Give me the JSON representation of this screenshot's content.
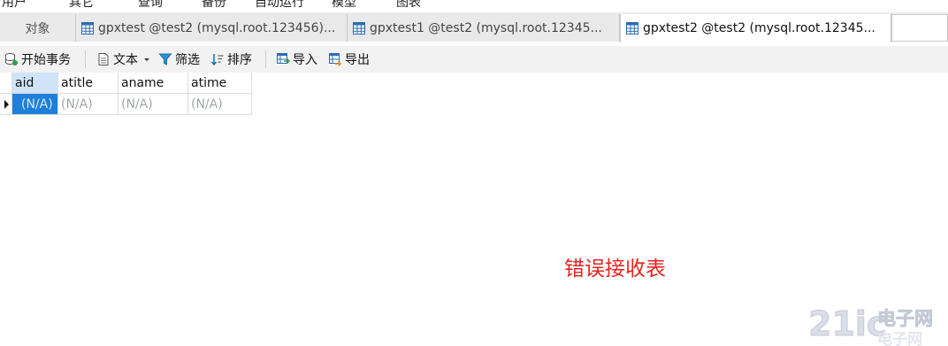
{
  "menubar": {
    "items": [
      "用户",
      "其它",
      "查询",
      "备份",
      "自动运行",
      "模型",
      "图表"
    ]
  },
  "tabs": {
    "objects_label": "对象",
    "items": [
      {
        "label": "gpxtest @test2 (mysql.root.123456)...",
        "icon": "table-icon",
        "active": false
      },
      {
        "label": "gpxtest1 @test2 (mysql.root.12345...",
        "icon": "table-icon",
        "active": false
      },
      {
        "label": "gpxtest2 @test2 (mysql.root.12345...",
        "icon": "table-icon",
        "active": true
      }
    ]
  },
  "toolbar": {
    "begin_transaction": "开始事务",
    "text": "文本",
    "filter": "筛选",
    "sort": "排序",
    "import": "导入",
    "export": "导出"
  },
  "grid": {
    "columns": [
      "aid",
      "atitle",
      "aname",
      "atime"
    ],
    "rows": [
      [
        "(N/A)",
        "(N/A)",
        "(N/A)",
        "(N/A)"
      ]
    ]
  },
  "annotation": "错误接收表",
  "watermark": {
    "logo": "21ic",
    "text": "电子网"
  },
  "colors": {
    "selection": "#1e7fd8",
    "header_selected": "#cfe4f8",
    "annotation": "#e5231f"
  }
}
